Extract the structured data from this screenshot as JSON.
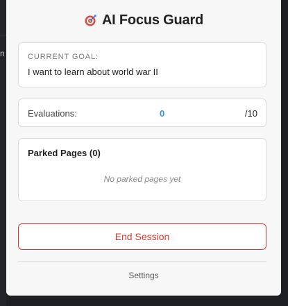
{
  "background": {
    "partial_text": "n"
  },
  "header": {
    "icon": "target-icon",
    "title": "AI Focus Guard"
  },
  "goal": {
    "label": "CURRENT GOAL:",
    "text": "I want to learn about world war II"
  },
  "evaluations": {
    "label": "Evaluations:",
    "count": "0",
    "max": "/10"
  },
  "parked": {
    "title": "Parked Pages (0)",
    "empty_text": "No parked pages yet"
  },
  "actions": {
    "end_session": "End Session",
    "settings": "Settings"
  },
  "colors": {
    "accent_blue": "#3c8fe0",
    "danger_red": "#d93a2f",
    "title_dark": "#222222"
  }
}
